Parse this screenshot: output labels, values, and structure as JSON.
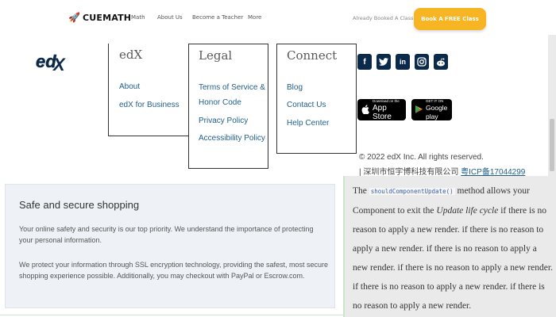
{
  "topnav": {
    "brand": "CUEMATH",
    "links": [
      "Math",
      "About Us",
      "Become a Teacher",
      "More"
    ],
    "already_booked": "Already Booked A Class?",
    "cta_label": "Book A FREE Class"
  },
  "edx": {
    "logo_text": "edX",
    "columns": [
      {
        "title": "edX",
        "links": [
          "About",
          "edX for Business"
        ]
      },
      {
        "title": "Legal",
        "links": [
          "Terms of Service &",
          "Honor Code",
          "Privacy Policy",
          "Accessibility Policy"
        ]
      },
      {
        "title": "Connect",
        "links": [
          "Blog",
          "Contact Us",
          "Help Center"
        ]
      }
    ],
    "social_icons": [
      "facebook-icon",
      "twitter-icon",
      "linkedin-icon",
      "instagram-icon",
      "reddit-icon"
    ],
    "app_store": {
      "small": "Download on the",
      "big": "App Store"
    },
    "google_play": {
      "small": "GET IT ON",
      "big": "Google play"
    },
    "copyright": "© 2022 edX Inc. All rights reserved.",
    "icp_prefix": "| 深圳市恒宇博科技有限公司 ",
    "icp_link": "粤ICP备17044299"
  },
  "safe_shopping": {
    "title": "Safe and secure shopping",
    "paragraph1": "Your online safety and security is our top priority. We understand the importance of protecting your personal information.",
    "paragraph2": "We protect your information through SSL encryption technology, providing the safest, most secure shopping experience possible. Additionally, you may checkout with PayPal or Escrow.com."
  },
  "react_note": {
    "prefix": "The ",
    "code": "shouldComponentUpdate()",
    "middle": " method allows your Component to exit the ",
    "emphasis": "Update life cycle",
    "suffix": " if there is no reason to apply a new render. if there is no reason to apply a new render. if there is no reason to apply a new render. if there is no reason to apply a new render. if there is no reason to apply a new render. if there is no reason to apply a new render."
  }
}
